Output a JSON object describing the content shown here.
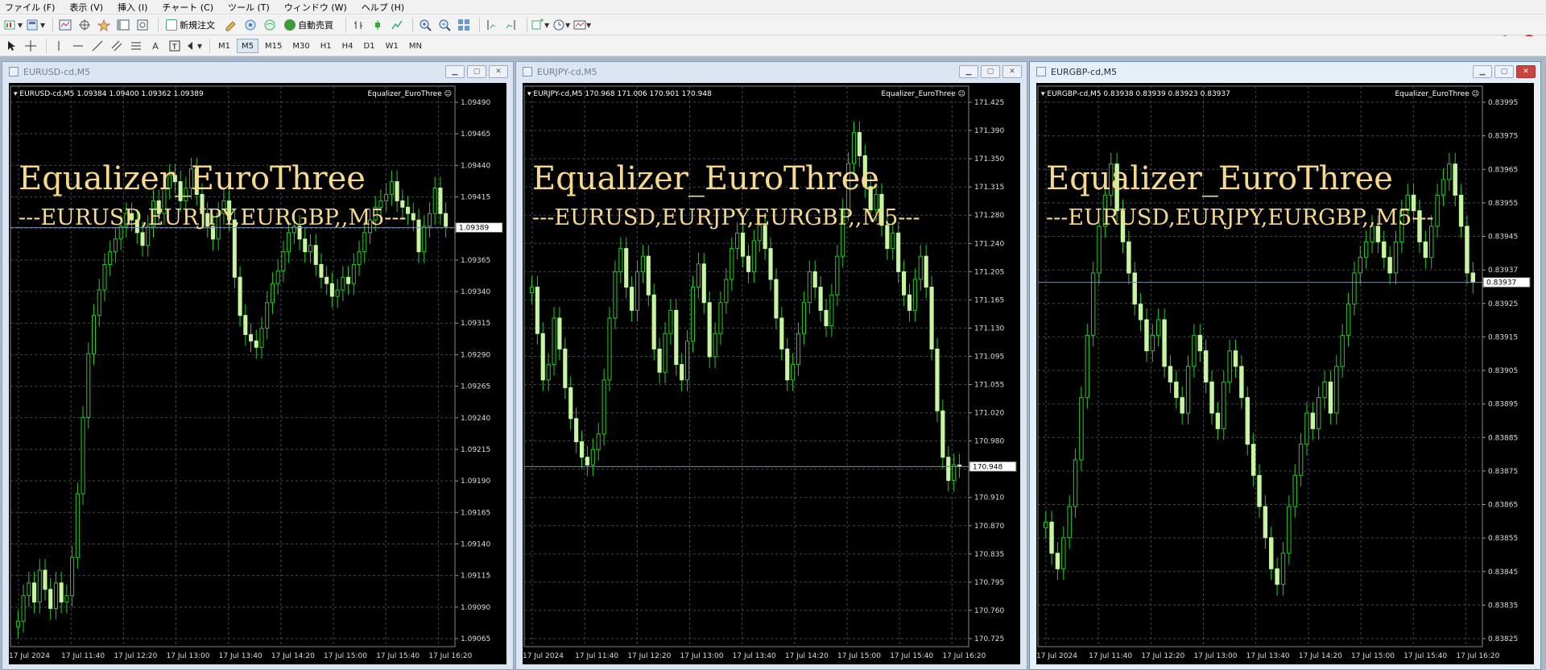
{
  "menu": [
    "ファイル (F)",
    "表示 (V)",
    "挿入 (I)",
    "チャート (C)",
    "ツール (T)",
    "ウィンドウ (W)",
    "ヘルプ (H)"
  ],
  "toolbar": {
    "new_order_label": "新規注文",
    "auto_trade_label": "自動売買",
    "timeframes": [
      "M1",
      "M5",
      "M15",
      "M30",
      "H1",
      "H4",
      "D1",
      "W1",
      "MN"
    ],
    "active_timeframe": "M5",
    "notification_count": "1"
  },
  "colors": {
    "bull_body": "#c8f5a0",
    "wick": "#22cc22",
    "grid": "#3a4a5a",
    "overlay_text": "#f7d98c",
    "chart_bg": "#000000"
  },
  "charts": [
    {
      "window_title": "EURUSD-cd,M5",
      "info": "EURUSD-cd,M5  1.09384 1.09400 1.09362 1.09389",
      "indicator": "Equalizer_EuroThree",
      "overlay_line1": "Equalizer_EuroThree",
      "overlay_line2": "---EURUSD,EURJPY,EURGBP,,M5---",
      "y_ticks": [
        "1.09490",
        "1.09465",
        "1.09440",
        "1.09415",
        "1.09390",
        "1.09365",
        "1.09340",
        "1.09315",
        "1.09290",
        "1.09265",
        "1.09240",
        "1.09215",
        "1.09190",
        "1.09165",
        "1.09140",
        "1.09115",
        "1.09090",
        "1.09065"
      ],
      "y_min": 1.0906,
      "y_max": 1.095,
      "current_price": "1.09389",
      "current_value": 1.09389,
      "x_ticks": [
        "17 Jul 2024",
        "17 Jul 11:40",
        "17 Jul 12:20",
        "17 Jul 13:00",
        "17 Jul 13:40",
        "17 Jul 14:20",
        "17 Jul 15:00",
        "17 Jul 15:40",
        "17 Jul 16:20"
      ],
      "close_series": [
        1.0908,
        1.091,
        1.0911,
        1.09095,
        1.0912,
        1.09105,
        1.0909,
        1.0911,
        1.09095,
        1.091,
        1.0913,
        1.0918,
        1.0924,
        1.0929,
        1.0932,
        1.0934,
        1.0936,
        1.0937,
        1.0938,
        1.0939,
        1.094,
        1.09395,
        1.09385,
        1.09375,
        1.0939,
        1.0941,
        1.094,
        1.0942,
        1.0943,
        1.09425,
        1.0941,
        1.0942,
        1.09435,
        1.09415,
        1.094,
        1.0939,
        1.0938,
        1.094,
        1.0941,
        1.09395,
        1.0935,
        1.0932,
        1.09305,
        1.093,
        1.09295,
        1.0931,
        1.0933,
        1.09345,
        1.09355,
        1.0937,
        1.09385,
        1.0939,
        1.0938,
        1.0937,
        1.09375,
        1.0936,
        1.0935,
        1.09345,
        1.09335,
        1.0934,
        1.0935,
        1.09345,
        1.0936,
        1.0937,
        1.09385,
        1.09395,
        1.09405,
        1.0941,
        1.09415,
        1.09425,
        1.0941,
        1.09405,
        1.094,
        1.09395,
        1.0937,
        1.0939,
        1.094,
        1.0942,
        1.094,
        1.0939
      ]
    },
    {
      "window_title": "EURJPY-cd,M5",
      "info": "EURJPY-cd,M5  170.968 171.006 170.901 170.948",
      "indicator": "Equalizer_EuroThree",
      "overlay_line1": "Equalizer_EuroThree",
      "overlay_line2": "---EURUSD,EURJPY,EURGBP,,M5---",
      "y_ticks": [
        "171.425",
        "171.390",
        "171.350",
        "171.315",
        "171.280",
        "171.240",
        "171.205",
        "171.165",
        "171.130",
        "171.095",
        "171.055",
        "171.020",
        "170.980",
        "170.948",
        "170.910",
        "170.870",
        "170.835",
        "170.795",
        "170.760",
        "170.725"
      ],
      "y_min": 170.715,
      "y_max": 171.44,
      "current_price": "170.948",
      "current_value": 170.948,
      "x_ticks": [
        "17 Jul 2024",
        "17 Jul 11:40",
        "17 Jul 12:20",
        "17 Jul 13:00",
        "17 Jul 13:40",
        "17 Jul 14:20",
        "17 Jul 15:00",
        "17 Jul 15:40",
        "17 Jul 16:20"
      ],
      "close_series": [
        171.18,
        171.12,
        171.06,
        171.08,
        171.14,
        171.1,
        171.05,
        171.01,
        170.98,
        170.96,
        170.95,
        170.97,
        170.99,
        171.06,
        171.14,
        171.2,
        171.23,
        171.18,
        171.15,
        171.2,
        171.22,
        171.17,
        171.1,
        171.07,
        171.12,
        171.15,
        171.08,
        171.06,
        171.11,
        171.18,
        171.21,
        171.16,
        171.09,
        171.12,
        171.16,
        171.19,
        171.23,
        171.25,
        171.22,
        171.2,
        171.24,
        171.26,
        171.23,
        171.19,
        171.14,
        171.1,
        171.06,
        171.08,
        171.12,
        171.16,
        171.2,
        171.18,
        171.15,
        171.13,
        171.17,
        171.22,
        171.28,
        171.34,
        171.38,
        171.35,
        171.31,
        171.28,
        171.3,
        171.26,
        171.23,
        171.25,
        171.2,
        171.17,
        171.15,
        171.19,
        171.22,
        171.18,
        171.1,
        171.02,
        170.96,
        170.93,
        170.95,
        170.948
      ]
    },
    {
      "window_title": "EURGBP-cd,M5",
      "info": "EURGBP-cd,M5  0.83938 0.83939 0.83923 0.83937",
      "indicator": "Equalizer_EuroThree",
      "overlay_line1": "Equalizer_EuroThree",
      "overlay_line2": "---EURUSD,EURJPY,EURGBP,,M5---",
      "y_ticks": [
        "0.83995",
        "0.83975",
        "0.83965",
        "0.83955",
        "0.83945",
        "0.83937",
        "0.83925",
        "0.83915",
        "0.83905",
        "0.83895",
        "0.83885",
        "0.83875",
        "0.83865",
        "0.83855",
        "0.83845",
        "0.83835",
        "0.83825"
      ],
      "y_min": 0.8382,
      "y_max": 0.84,
      "current_price": "0.83937",
      "current_value": 0.83937,
      "x_ticks": [
        "17 Jul 2024",
        "17 Jul 11:40",
        "17 Jul 12:20",
        "17 Jul 13:00",
        "17 Jul 13:40",
        "17 Jul 14:20",
        "17 Jul 15:00",
        "17 Jul 15:40",
        "17 Jul 16:20"
      ],
      "close_series": [
        0.8386,
        0.8385,
        0.83845,
        0.83855,
        0.83865,
        0.8388,
        0.839,
        0.8392,
        0.8394,
        0.83955,
        0.83965,
        0.83975,
        0.8396,
        0.8395,
        0.8394,
        0.8393,
        0.83925,
        0.83915,
        0.8392,
        0.83925,
        0.8391,
        0.83905,
        0.839,
        0.83895,
        0.8391,
        0.8392,
        0.83915,
        0.83905,
        0.83895,
        0.8389,
        0.83905,
        0.83915,
        0.8391,
        0.839,
        0.83885,
        0.83875,
        0.83865,
        0.83855,
        0.83845,
        0.8384,
        0.8385,
        0.83865,
        0.83875,
        0.83885,
        0.83895,
        0.8389,
        0.839,
        0.83905,
        0.83895,
        0.8391,
        0.8392,
        0.8393,
        0.8394,
        0.83945,
        0.8395,
        0.83955,
        0.8395,
        0.83945,
        0.8394,
        0.8395,
        0.8396,
        0.83965,
        0.8396,
        0.8395,
        0.83945,
        0.83955,
        0.83965,
        0.8397,
        0.83975,
        0.83965,
        0.83955,
        0.8394,
        0.83937
      ]
    }
  ]
}
